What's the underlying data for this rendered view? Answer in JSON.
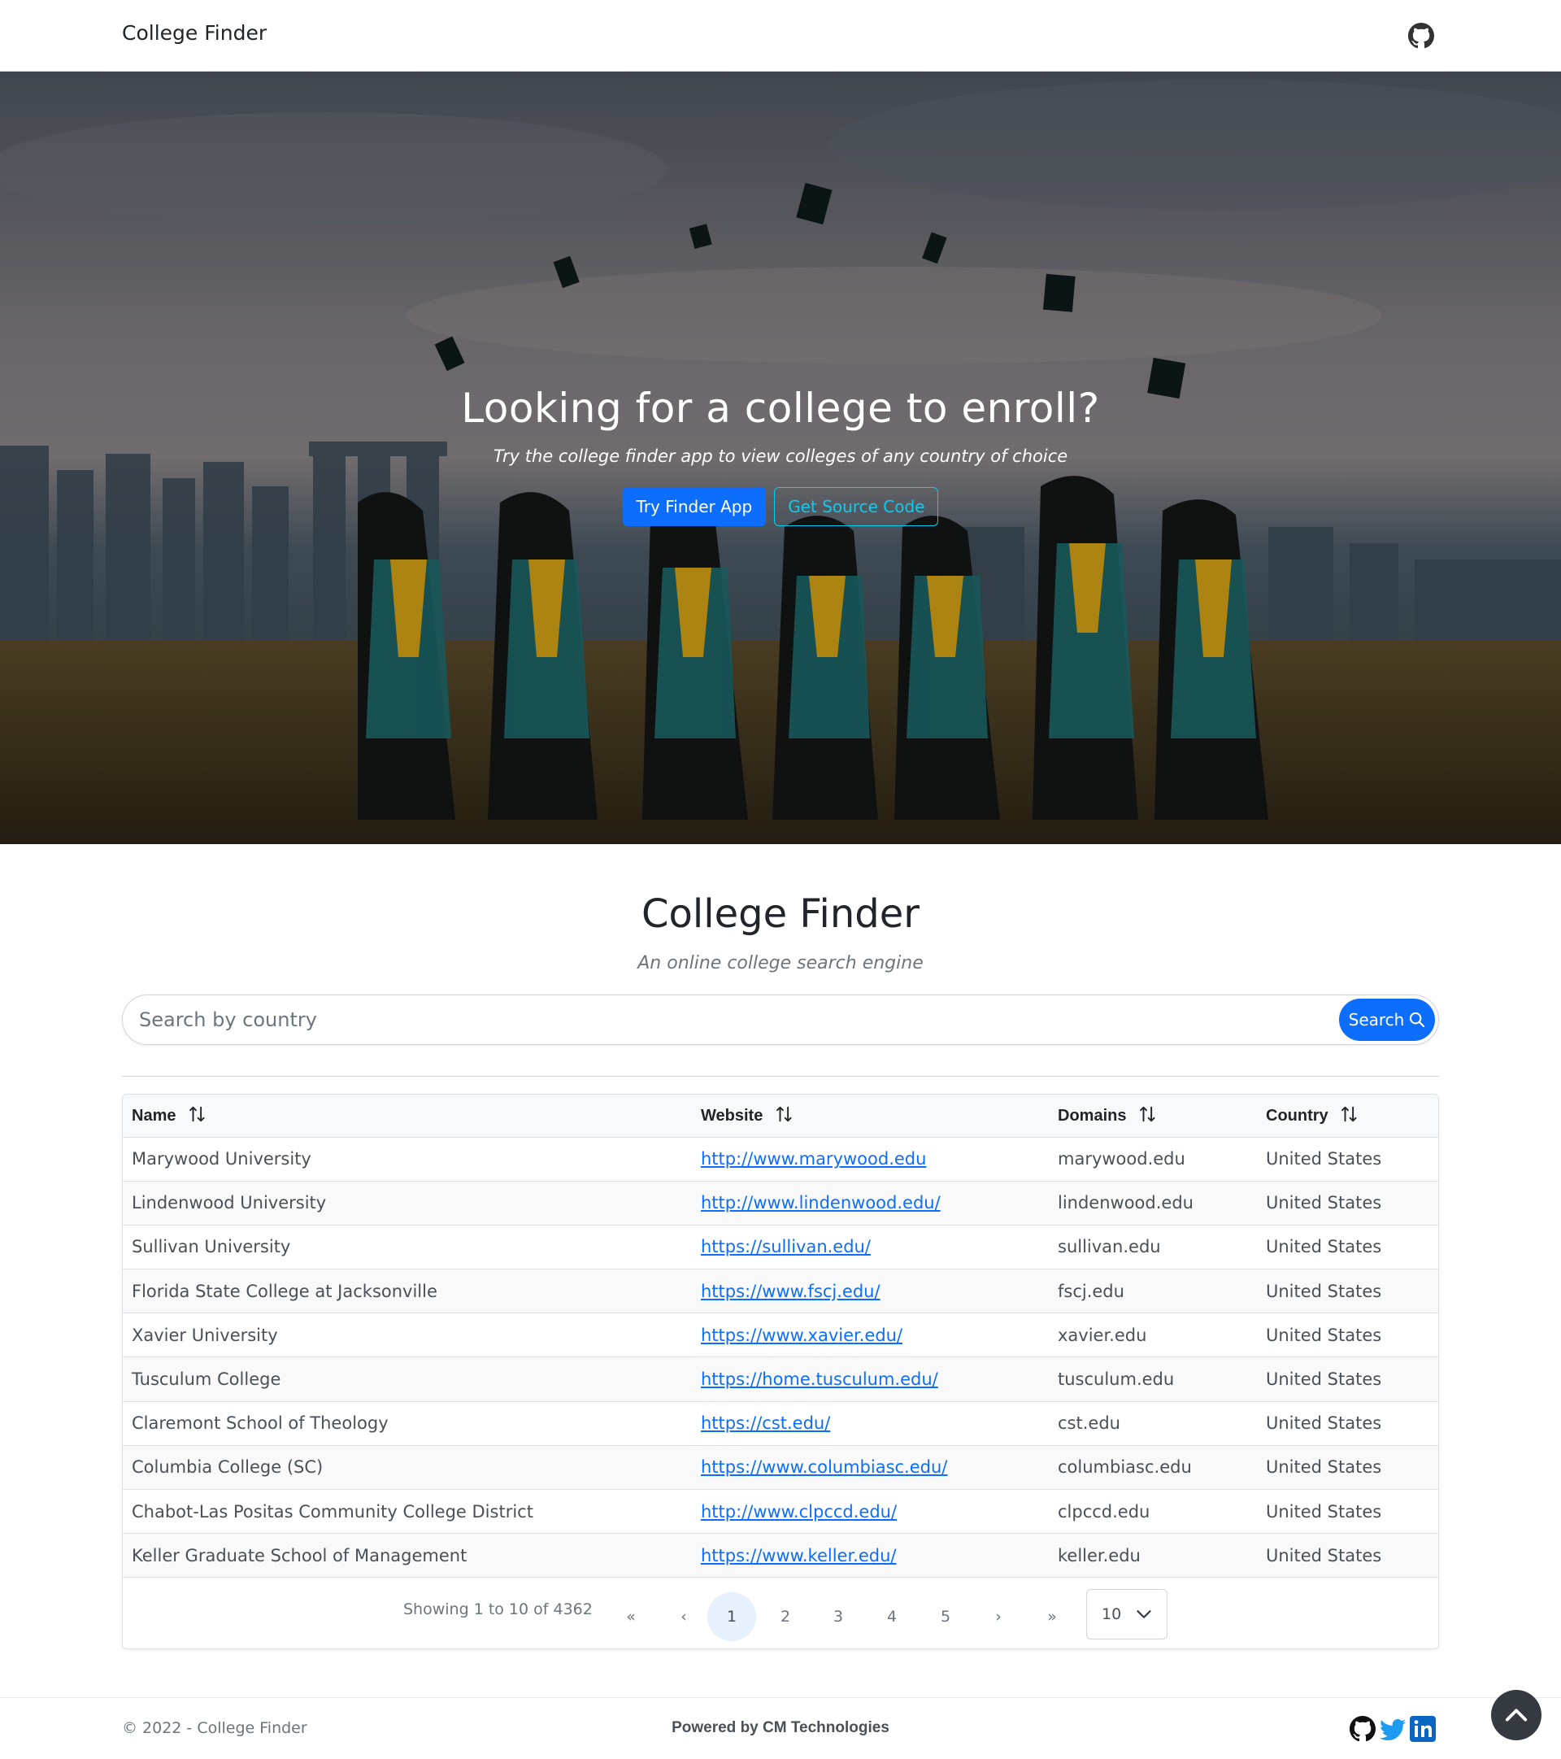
{
  "navbar": {
    "brand": "College Finder",
    "github_icon": "github-icon"
  },
  "hero": {
    "title": "Looking for a college to enroll?",
    "subtitle": "Try the college finder app to view colleges of any country of choice",
    "primary_button": "Try Finder App",
    "secondary_button": "Get Source Code"
  },
  "main": {
    "title": "College Finder",
    "subtitle": "An online college search engine",
    "search": {
      "placeholder": "Search by country",
      "value": "",
      "button_label": "Search",
      "button_icon": "search-icon"
    }
  },
  "table": {
    "columns": [
      {
        "label": "Name",
        "sort_icon": "sort-icon"
      },
      {
        "label": "Website",
        "sort_icon": "sort-icon"
      },
      {
        "label": "Domains",
        "sort_icon": "sort-icon"
      },
      {
        "label": "Country",
        "sort_icon": "sort-icon"
      }
    ],
    "rows": [
      {
        "name": "Marywood University",
        "website": "http://www.marywood.edu",
        "domain": "marywood.edu",
        "country": "United States"
      },
      {
        "name": "Lindenwood University",
        "website": "http://www.lindenwood.edu/",
        "domain": "lindenwood.edu",
        "country": "United States"
      },
      {
        "name": "Sullivan University",
        "website": "https://sullivan.edu/",
        "domain": "sullivan.edu",
        "country": "United States"
      },
      {
        "name": "Florida State College at Jacksonville",
        "website": "https://www.fscj.edu/",
        "domain": "fscj.edu",
        "country": "United States"
      },
      {
        "name": "Xavier University",
        "website": "https://www.xavier.edu/",
        "domain": "xavier.edu",
        "country": "United States"
      },
      {
        "name": "Tusculum College",
        "website": "https://home.tusculum.edu/",
        "domain": "tusculum.edu",
        "country": "United States"
      },
      {
        "name": "Claremont School of Theology",
        "website": "https://cst.edu/",
        "domain": "cst.edu",
        "country": "United States"
      },
      {
        "name": "Columbia College (SC)",
        "website": "https://www.columbiasc.edu/",
        "domain": "columbiasc.edu",
        "country": "United States"
      },
      {
        "name": "Chabot-Las Positas Community College District",
        "website": "http://www.clpccd.edu/",
        "domain": "clpccd.edu",
        "country": "United States"
      },
      {
        "name": "Keller Graduate School of Management",
        "website": "https://www.keller.edu/",
        "domain": "keller.edu",
        "country": "United States"
      }
    ],
    "pagination": {
      "info": "Showing 1 to 10 of 4362",
      "first": "«",
      "prev": "‹",
      "pages": [
        "1",
        "2",
        "3",
        "4",
        "5"
      ],
      "current_page": "1",
      "next": "›",
      "last": "»",
      "page_size": "10"
    }
  },
  "footer": {
    "copyright": "© 2022 - College Finder",
    "powered": "Powered by CM Technologies",
    "social": [
      "github-icon",
      "twitter-icon",
      "linkedin-icon"
    ],
    "back_to_top_icon": "chevron-up-icon"
  },
  "colors": {
    "primary": "#0d6efd",
    "info": "#0dcaf0",
    "dark": "#343a40",
    "muted": "#6c757d"
  }
}
